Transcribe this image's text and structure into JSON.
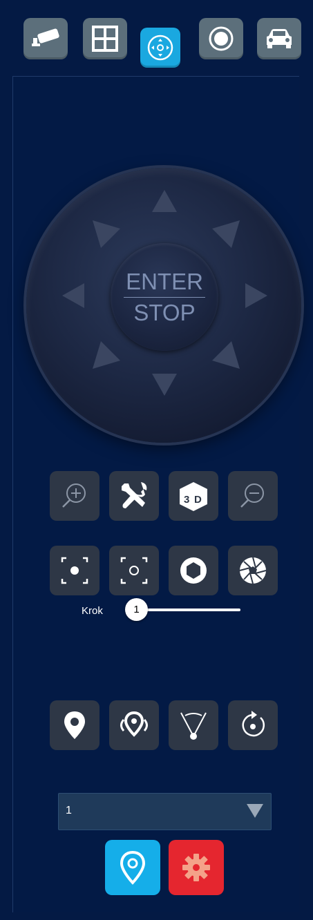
{
  "tabs": [
    {
      "icon": "bullet-camera-icon",
      "active": false
    },
    {
      "icon": "grid-layout-icon",
      "active": false
    },
    {
      "icon": "ptz-control-icon",
      "active": true
    },
    {
      "icon": "record-icon",
      "active": false
    },
    {
      "icon": "car-icon",
      "active": false
    }
  ],
  "joystick": {
    "enter_label": "ENTER",
    "stop_label": "STOP",
    "arrow_icons": [
      "up-arrow-icon",
      "up-right-arrow-icon",
      "right-arrow-icon",
      "down-right-arrow-icon",
      "down-arrow-icon",
      "down-left-arrow-icon",
      "left-arrow-icon",
      "up-left-arrow-icon"
    ]
  },
  "controls": {
    "row1": [
      "zoom-in-icon",
      "tools-icon",
      "3d-icon",
      "zoom-out-icon"
    ],
    "row2": [
      "focus-near-icon",
      "focus-far-icon",
      "iris-open-icon",
      "iris-close-icon"
    ],
    "row3": [
      "preset-pin-icon",
      "cruise-icon",
      "scan-icon",
      "rotate-icon"
    ]
  },
  "step": {
    "label": "Krok",
    "value": "1",
    "level": 0.0
  },
  "preset_select": {
    "value": "1"
  },
  "actions": [
    {
      "icon": "location-pin-icon",
      "color": "#15aee9"
    },
    {
      "icon": "settings-gear-icon",
      "color": "#e5262f"
    }
  ],
  "colors": {
    "background": "#041a44",
    "active_tab": "#1aa8e0",
    "tab": "#5c6f7b",
    "button": "#2e3746"
  }
}
